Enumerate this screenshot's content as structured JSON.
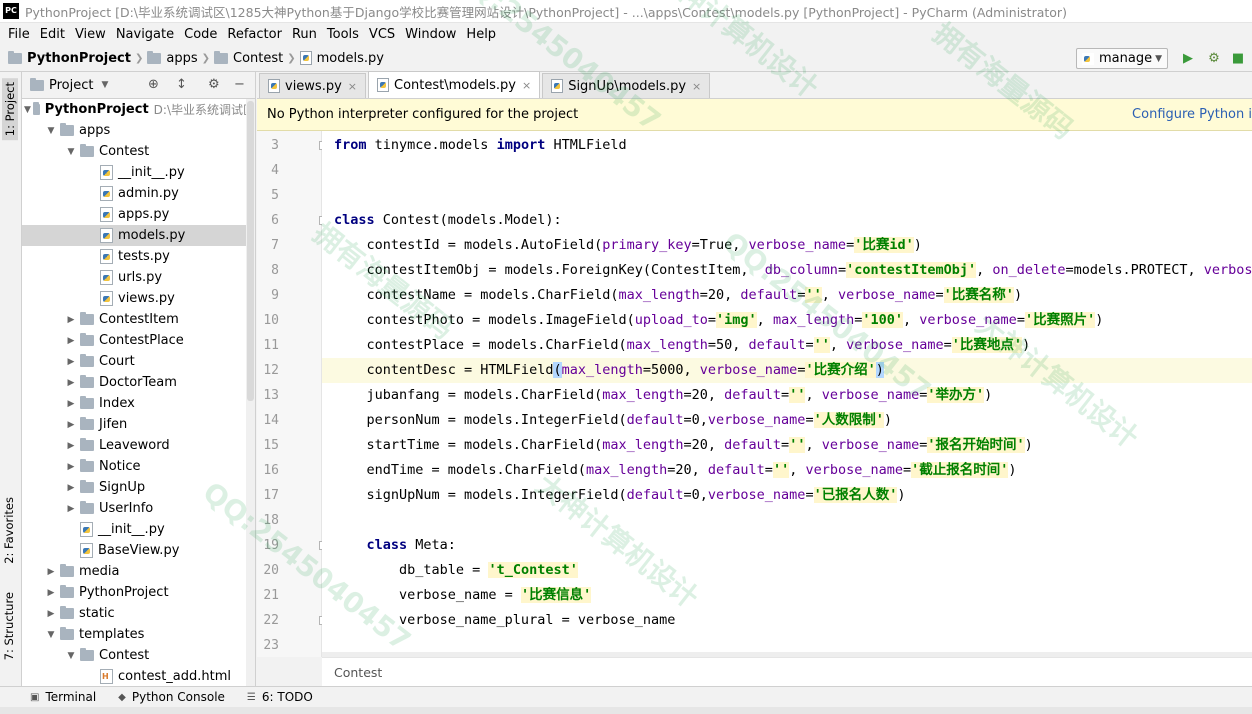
{
  "window": {
    "title": "PythonProject [D:\\毕业系统调试区\\1285大神Python基于Django学校比赛管理网站设计\\PythonProject] - ...\\apps\\Contest\\models.py [PythonProject] - PyCharm (Administrator)",
    "logo": "PC"
  },
  "menu": [
    "File",
    "Edit",
    "View",
    "Navigate",
    "Code",
    "Refactor",
    "Run",
    "Tools",
    "VCS",
    "Window",
    "Help"
  ],
  "navbar": {
    "crumbs": [
      "PythonProject",
      "apps",
      "Contest",
      "models.py"
    ],
    "run_config": "manage"
  },
  "side_tabs": {
    "project": "1: Project",
    "favorites": "2: Favorites",
    "structure": "7: Structure"
  },
  "project_panel": {
    "header": "Project",
    "root_name": "PythonProject",
    "root_path": "D:\\毕业系统调试区",
    "items": [
      {
        "label": "apps",
        "depth": 1,
        "kind": "folder",
        "expanded": true
      },
      {
        "label": "Contest",
        "depth": 2,
        "kind": "folder",
        "expanded": true
      },
      {
        "label": "__init__.py",
        "depth": 3,
        "kind": "py"
      },
      {
        "label": "admin.py",
        "depth": 3,
        "kind": "py"
      },
      {
        "label": "apps.py",
        "depth": 3,
        "kind": "py"
      },
      {
        "label": "models.py",
        "depth": 3,
        "kind": "py",
        "selected": true
      },
      {
        "label": "tests.py",
        "depth": 3,
        "kind": "py"
      },
      {
        "label": "urls.py",
        "depth": 3,
        "kind": "py"
      },
      {
        "label": "views.py",
        "depth": 3,
        "kind": "py"
      },
      {
        "label": "ContestItem",
        "depth": 2,
        "kind": "folder",
        "expanded": false
      },
      {
        "label": "ContestPlace",
        "depth": 2,
        "kind": "folder",
        "expanded": false
      },
      {
        "label": "Court",
        "depth": 2,
        "kind": "folder",
        "expanded": false
      },
      {
        "label": "DoctorTeam",
        "depth": 2,
        "kind": "folder",
        "expanded": false
      },
      {
        "label": "Index",
        "depth": 2,
        "kind": "folder",
        "expanded": false
      },
      {
        "label": "Jifen",
        "depth": 2,
        "kind": "folder",
        "expanded": false
      },
      {
        "label": "Leaveword",
        "depth": 2,
        "kind": "folder",
        "expanded": false
      },
      {
        "label": "Notice",
        "depth": 2,
        "kind": "folder",
        "expanded": false
      },
      {
        "label": "SignUp",
        "depth": 2,
        "kind": "folder",
        "expanded": false
      },
      {
        "label": "UserInfo",
        "depth": 2,
        "kind": "folder",
        "expanded": false
      },
      {
        "label": "__init__.py",
        "depth": 2,
        "kind": "py"
      },
      {
        "label": "BaseView.py",
        "depth": 2,
        "kind": "py"
      },
      {
        "label": "media",
        "depth": 1,
        "kind": "folder",
        "expanded": false
      },
      {
        "label": "PythonProject",
        "depth": 1,
        "kind": "folder",
        "expanded": false
      },
      {
        "label": "static",
        "depth": 1,
        "kind": "folder",
        "expanded": false
      },
      {
        "label": "templates",
        "depth": 1,
        "kind": "folder",
        "expanded": true
      },
      {
        "label": "Contest",
        "depth": 2,
        "kind": "folder",
        "expanded": true
      },
      {
        "label": "contest_add.html",
        "depth": 3,
        "kind": "html"
      }
    ]
  },
  "editor_tabs": [
    {
      "label": "views.py",
      "active": false
    },
    {
      "label": "Contest\\models.py",
      "active": true
    },
    {
      "label": "SignUp\\models.py",
      "active": false
    }
  ],
  "notice": {
    "message": "No Python interpreter configured for the project",
    "action": "Configure Python i"
  },
  "code": {
    "lines": [
      {
        "n": "3",
        "fold": true,
        "tokens": [
          [
            "kw",
            "from"
          ],
          [
            "t",
            " tinymce.models "
          ],
          [
            "kw",
            "import"
          ],
          [
            "t",
            " HTMLField"
          ]
        ]
      },
      {
        "n": "4",
        "tokens": []
      },
      {
        "n": "5",
        "tokens": []
      },
      {
        "n": "6",
        "fold": true,
        "tokens": [
          [
            "kw",
            "class"
          ],
          [
            "t",
            " Contest(models.Model):"
          ]
        ]
      },
      {
        "n": "7",
        "tokens": [
          [
            "t",
            "    contestId = models.AutoField("
          ],
          [
            "p",
            "primary_key"
          ],
          [
            "t",
            "=True, "
          ],
          [
            "p",
            "verbose_name"
          ],
          [
            "t",
            "="
          ],
          [
            "s",
            "'比赛id'"
          ],
          [
            "t",
            ")"
          ]
        ]
      },
      {
        "n": "8",
        "tokens": [
          [
            "t",
            "    contestItemObj = models.ForeignKey(ContestItem,  "
          ],
          [
            "p",
            "db_column"
          ],
          [
            "t",
            "="
          ],
          [
            "s",
            "'contestItemObj'"
          ],
          [
            "t",
            ", "
          ],
          [
            "p",
            "on_delete"
          ],
          [
            "t",
            "=models.PROTECT, "
          ],
          [
            "p",
            "verbose_"
          ]
        ]
      },
      {
        "n": "9",
        "tokens": [
          [
            "t",
            "    contestName = models.CharField("
          ],
          [
            "p",
            "max_length"
          ],
          [
            "t",
            "=20, "
          ],
          [
            "p",
            "default"
          ],
          [
            "t",
            "="
          ],
          [
            "s",
            "''"
          ],
          [
            "t",
            ", "
          ],
          [
            "p",
            "verbose_name"
          ],
          [
            "t",
            "="
          ],
          [
            "s",
            "'比赛名称'"
          ],
          [
            "t",
            ")"
          ]
        ]
      },
      {
        "n": "10",
        "tokens": [
          [
            "t",
            "    contestPhoto = models.ImageField("
          ],
          [
            "p",
            "upload_to"
          ],
          [
            "t",
            "="
          ],
          [
            "s",
            "'img'"
          ],
          [
            "t",
            ", "
          ],
          [
            "p",
            "max_length"
          ],
          [
            "t",
            "="
          ],
          [
            "s",
            "'100'"
          ],
          [
            "t",
            ", "
          ],
          [
            "p",
            "verbose_name"
          ],
          [
            "t",
            "="
          ],
          [
            "s",
            "'比赛照片'"
          ],
          [
            "t",
            ")"
          ]
        ]
      },
      {
        "n": "11",
        "tokens": [
          [
            "t",
            "    contestPlace = models.CharField("
          ],
          [
            "p",
            "max_length"
          ],
          [
            "t",
            "=50, "
          ],
          [
            "p",
            "default"
          ],
          [
            "t",
            "="
          ],
          [
            "s",
            "''"
          ],
          [
            "t",
            ", "
          ],
          [
            "p",
            "verbose_name"
          ],
          [
            "t",
            "="
          ],
          [
            "s",
            "'比赛地点'"
          ],
          [
            "t",
            ")"
          ]
        ]
      },
      {
        "n": "12",
        "current": true,
        "bulb": true,
        "tokens": [
          [
            "t",
            "    contentDesc = HTMLField"
          ],
          [
            "sel",
            "("
          ],
          [
            "p",
            "max_length"
          ],
          [
            "t",
            "=5000, "
          ],
          [
            "p",
            "verbose_name"
          ],
          [
            "t",
            "="
          ],
          [
            "s",
            "'比赛介绍'"
          ],
          [
            "sel",
            ")"
          ]
        ]
      },
      {
        "n": "13",
        "tokens": [
          [
            "t",
            "    jubanfang = models.CharField("
          ],
          [
            "p",
            "max_length"
          ],
          [
            "t",
            "=20, "
          ],
          [
            "p",
            "default"
          ],
          [
            "t",
            "="
          ],
          [
            "s",
            "''"
          ],
          [
            "t",
            ", "
          ],
          [
            "p",
            "verbose_name"
          ],
          [
            "t",
            "="
          ],
          [
            "s",
            "'举办方'"
          ],
          [
            "t",
            ")"
          ]
        ]
      },
      {
        "n": "14",
        "tokens": [
          [
            "t",
            "    personNum = models.IntegerField("
          ],
          [
            "p",
            "default"
          ],
          [
            "t",
            "=0,"
          ],
          [
            "p",
            "verbose_name"
          ],
          [
            "t",
            "="
          ],
          [
            "s",
            "'人数限制'"
          ],
          [
            "t",
            ")"
          ]
        ]
      },
      {
        "n": "15",
        "tokens": [
          [
            "t",
            "    startTime = models.CharField("
          ],
          [
            "p",
            "max_length"
          ],
          [
            "t",
            "=20, "
          ],
          [
            "p",
            "default"
          ],
          [
            "t",
            "="
          ],
          [
            "s",
            "''"
          ],
          [
            "t",
            ", "
          ],
          [
            "p",
            "verbose_name"
          ],
          [
            "t",
            "="
          ],
          [
            "s",
            "'报名开始时间'"
          ],
          [
            "t",
            ")"
          ]
        ]
      },
      {
        "n": "16",
        "tokens": [
          [
            "t",
            "    endTime = models.CharField("
          ],
          [
            "p",
            "max_length"
          ],
          [
            "t",
            "=20, "
          ],
          [
            "p",
            "default"
          ],
          [
            "t",
            "="
          ],
          [
            "s",
            "''"
          ],
          [
            "t",
            ", "
          ],
          [
            "p",
            "verbose_name"
          ],
          [
            "t",
            "="
          ],
          [
            "s",
            "'截止报名时间'"
          ],
          [
            "t",
            ")"
          ]
        ]
      },
      {
        "n": "17",
        "tokens": [
          [
            "t",
            "    signUpNum = models.IntegerField("
          ],
          [
            "p",
            "default"
          ],
          [
            "t",
            "=0,"
          ],
          [
            "p",
            "verbose_name"
          ],
          [
            "t",
            "="
          ],
          [
            "s",
            "'已报名人数'"
          ],
          [
            "t",
            ")"
          ]
        ]
      },
      {
        "n": "18",
        "tokens": []
      },
      {
        "n": "19",
        "fold": true,
        "tokens": [
          [
            "t",
            "    "
          ],
          [
            "kw",
            "class"
          ],
          [
            "t",
            " Meta:"
          ]
        ]
      },
      {
        "n": "20",
        "tokens": [
          [
            "t",
            "        db_table = "
          ],
          [
            "s",
            "'t_Contest'"
          ]
        ]
      },
      {
        "n": "21",
        "tokens": [
          [
            "t",
            "        verbose_name = "
          ],
          [
            "s",
            "'比赛信息'"
          ]
        ]
      },
      {
        "n": "22",
        "fold": true,
        "tokens": [
          [
            "t",
            "        verbose_name_plural = verbose_name"
          ]
        ]
      },
      {
        "n": "23",
        "tokens": []
      }
    ],
    "footer_crumb": "Contest"
  },
  "bottom_tools": [
    "Terminal",
    "Python Console",
    "6: TODO"
  ],
  "watermarks": [
    "QQ:2545040457",
    "大神计算机设计",
    "拥有海量源码"
  ],
  "colors": {
    "keyword": "#000080",
    "param": "#660099",
    "string": "#008000",
    "notice_bg": "#fffbd6",
    "link": "#2b5fb3"
  }
}
